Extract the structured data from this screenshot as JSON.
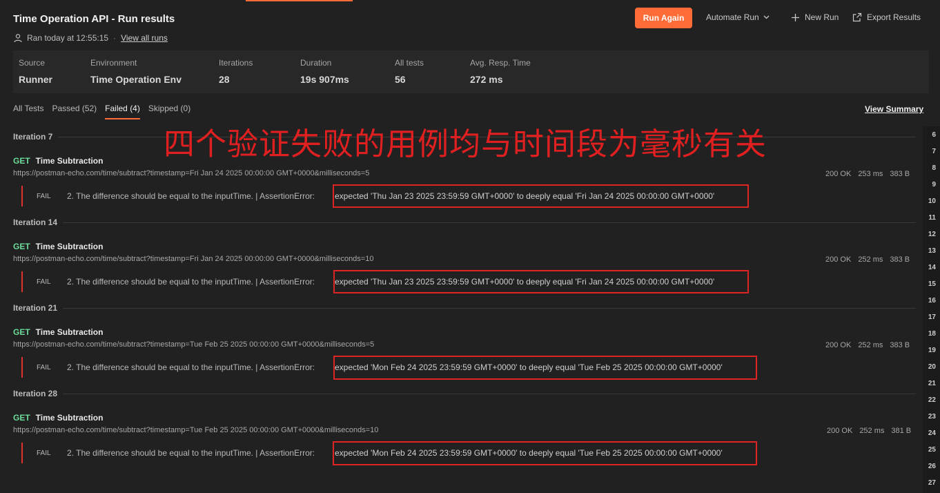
{
  "header": {
    "title": "Time Operation API - Run results",
    "ran": "Ran today at 12:55:15",
    "separator": "·",
    "view_all_runs": "View all runs",
    "run_again": "Run Again",
    "automate_run": "Automate Run",
    "new_run": "New Run",
    "export_results": "Export Results"
  },
  "stats": [
    {
      "label": "Source",
      "value": "Runner"
    },
    {
      "label": "Environment",
      "value": "Time Operation Env"
    },
    {
      "label": "Iterations",
      "value": "28"
    },
    {
      "label": "Duration",
      "value": "19s 907ms"
    },
    {
      "label": "All tests",
      "value": "56"
    },
    {
      "label": "Avg. Resp. Time",
      "value": "272 ms"
    }
  ],
  "tabs": [
    "All Tests",
    "Passed (52)",
    "Failed (4)",
    "Skipped (0)"
  ],
  "active_tab": "Failed (4)",
  "view_summary": "View Summary",
  "annotation": "四个验证失败的用例均与时间段为毫秒有关",
  "iterations": [
    {
      "title": "Iteration 7",
      "method": "GET",
      "name": "Time Subtraction",
      "url": "https://postman-echo.com/time/subtract?timestamp=Fri Jan 24 2025 00:00:00 GMT+0000&milliseconds=5",
      "status": "200 OK",
      "time": "253 ms",
      "size": "383 B",
      "fail_tag": "FAIL",
      "fail_msg": "2. The difference should be equal to the inputTime. | AssertionError:",
      "expected": "expected 'Thu Jan 23 2025 23:59:59 GMT+0000' to deeply equal 'Fri Jan 24 2025 00:00:00 GMT+0000'"
    },
    {
      "title": "Iteration 14",
      "method": "GET",
      "name": "Time Subtraction",
      "url": "https://postman-echo.com/time/subtract?timestamp=Fri Jan 24 2025 00:00:00 GMT+0000&milliseconds=10",
      "status": "200 OK",
      "time": "252 ms",
      "size": "383 B",
      "fail_tag": "FAIL",
      "fail_msg": "2. The difference should be equal to the inputTime. | AssertionError:",
      "expected": "expected 'Thu Jan 23 2025 23:59:59 GMT+0000' to deeply equal 'Fri Jan 24 2025 00:00:00 GMT+0000'"
    },
    {
      "title": "Iteration 21",
      "method": "GET",
      "name": "Time Subtraction",
      "url": "https://postman-echo.com/time/subtract?timestamp=Tue Feb 25 2025 00:00:00 GMT+0000&milliseconds=5",
      "status": "200 OK",
      "time": "252 ms",
      "size": "383 B",
      "fail_tag": "FAIL",
      "fail_msg": "2. The difference should be equal to the inputTime. | AssertionError:",
      "expected": "expected 'Mon Feb 24 2025 23:59:59 GMT+0000' to deeply equal 'Tue Feb 25 2025 00:00:00 GMT+0000'"
    },
    {
      "title": "Iteration 28",
      "method": "GET",
      "name": "Time Subtraction",
      "url": "https://postman-echo.com/time/subtract?timestamp=Tue Feb 25 2025 00:00:00 GMT+0000&milliseconds=10",
      "status": "200 OK",
      "time": "252 ms",
      "size": "381 B",
      "fail_tag": "FAIL",
      "fail_msg": "2. The difference should be equal to the inputTime. | AssertionError:",
      "expected": "expected 'Mon Feb 24 2025 23:59:59 GMT+0000' to deeply equal 'Tue Feb 25 2025 00:00:00 GMT+0000'"
    }
  ],
  "gutter_numbers": [
    "6",
    "7",
    "8",
    "9",
    "10",
    "11",
    "12",
    "13",
    "14",
    "15",
    "16",
    "17",
    "18",
    "19",
    "20",
    "21",
    "22",
    "23",
    "24",
    "25",
    "26",
    "27"
  ],
  "colors": {
    "accent": "#ff6c37",
    "get": "#6bdd9a",
    "fail": "#e0302a",
    "annotation": "#e02020"
  }
}
